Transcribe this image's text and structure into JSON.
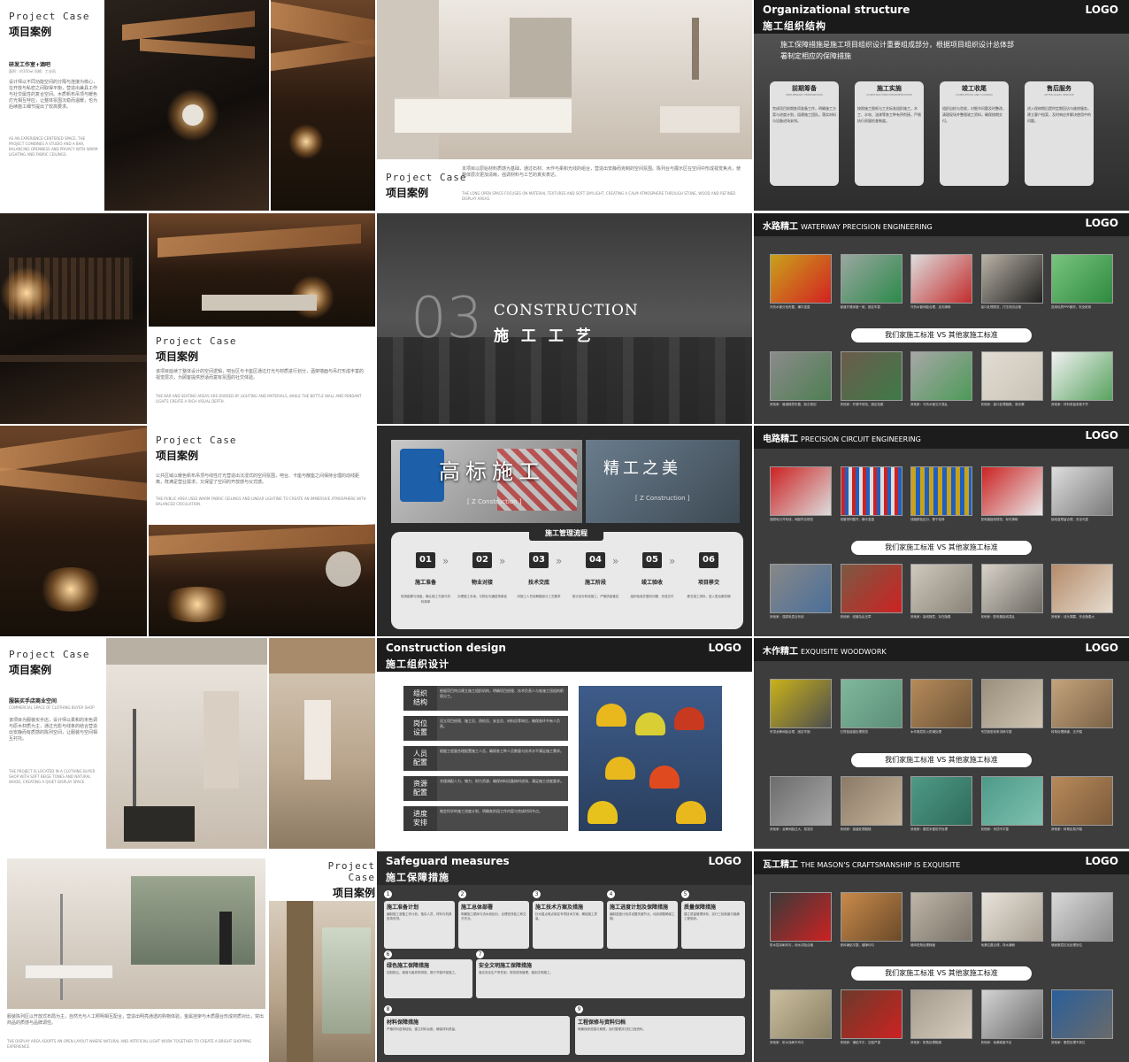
{
  "project_case": {
    "en": "Project Case",
    "cn": "项目案例"
  },
  "s1": {
    "subtitle": "研发工作室+酒吧",
    "meta": "面积：约350㎡ 风格：工业风",
    "body": "设计师以不同功能空间的分隔与连接为核心，在开放与私密之间取得平衡，营造出兼具工作与社交属性的复合空间。木质帆布吊顶与暖色灯光相互呼应，让整体氛围沉稳而温暖，也为后续施工细节提出了较高要求。",
    "body_en": "AS AN EXPERIENCE-CENTERED SPACE, THE PROJECT COMBINES A STUDIO AND A BAR, BALANCING OPENNESS AND PRIVACY WITH WARM LIGHTING AND FABRIC CEILINGS."
  },
  "s2": {
    "body": "本项目以原始材料质感为基础，通过石材、木作与柔和光线的组合，营造出安静而克制的空间氛围。陈列台与展示区在空间中形成视觉焦点，使整体层次更加清晰，强调材料与工艺的真实表达。",
    "body_en": "THE LONG OPEN SPACE FOCUSES ON MATERIAL TEXTURES AND SOFT DAYLIGHT, CREATING A CALM ATMOSPHERE THROUGH STONE, WOOD AND REFINED DISPLAY AREAS."
  },
  "s3": {
    "en": "Organizational structure",
    "cn": "施工组织结构",
    "logo": "LOGO",
    "intro": "施工保障措施是施工项目组织设计重要组成部分，根据项目组织设计总体部署制定相应的保障措施",
    "cards": [
      {
        "title": "前期筹备",
        "en": "PRELIMINARY PREPARATION",
        "body": "完成项目前期各项准备工作，明确施工方案与进度计划，组建施工团队，落实材料与设备进场安排。"
      },
      {
        "title": "施工实施",
        "en": "CONSTRUCTION IMPLEMENTATION",
        "body": "按照施工图纸与工艺标准组织施工，木工、水电、油漆等各工种有序衔接，严格执行质量检查制度。"
      },
      {
        "title": "竣工收尾",
        "en": "COMPLETION AND CLOSING",
        "body": "组织自检与验收，对细节问题及时整改，清理现场并整理竣工资料，确保按期交付。"
      },
      {
        "title": "售后服务",
        "en": "AFTER-SALES SERVICE",
        "body": "进入保修期后提供定期回访与维修服务，建立客户档案，及时响应并解决使用中的问题。"
      }
    ]
  },
  "s4": {
    "body": "该项目延续了整体设计的空间逻辑，吧台区与卡座区通过灯光与材质进行划分，酒架墙面与吊灯形成丰富的视觉层次，为顾客提供舒适而富有氛围的社交体验。",
    "body_en": "THE BAR AND SEATING AREAS ARE DIVIDED BY LIGHTING AND MATERIALS, WHILE THE BOTTLE WALL AND PENDANT LIGHTS CREATE A RICH VISUAL DEPTH."
  },
  "s5": {
    "num": "03",
    "en": "CONSTRUCTION",
    "cn": "施 工 工 艺"
  },
  "s6": {
    "title": "水路精工",
    "title_en": "WATERWAY PRECISION ENGINEERING",
    "logo": "LOGO",
    "vs": "我们家施工标准  VS  其他家施工标准",
    "caps_top": [
      "冷热水管分色布置，横平竖直",
      "管道开槽深度一致，固定牢靠",
      "冷热水管间距合理，走向清晰",
      "接口处理规范，打压测试合格",
      "选用优质PPR管材，安全耐用"
    ],
    "caps_bottom": [
      "其他家：管道随意布置，缺乏规划",
      "其他家：开槽不规范，固定松散",
      "其他家：冷热水管交叉混乱",
      "其他家：接口处理粗糙，易渗漏",
      "其他家：材料质量参差不齐"
    ]
  },
  "s7": {
    "body": "公共区域以暖色帆布吊顶与线性灯光营造出沉浸式的空间氛围，吧台、卡座与散座之间保持合理的动线距离，既满足营业需求，又保留了空间的开放感与仪式感。",
    "body_en": "THE PUBLIC AREA USES WARM FABRIC CEILINGS AND LINEAR LIGHTING TO CREATE AN IMMERSIVE ATMOSPHERE WITH BALANCED CIRCULATION."
  },
  "s8": {
    "banner_left": "高标施工",
    "banner_left_sub": "[ Z Construction ]",
    "banner_right": "精工之美",
    "banner_right_sub": "[ Z Construction ]",
    "process_title": "施工管理流程",
    "steps": [
      {
        "num": "01",
        "name": "施工准备",
        "desc": "现场勘察与测量，确认施工方案与材料清单"
      },
      {
        "num": "02",
        "name": "物业对接",
        "desc": "办理施工手续，与物业沟通进场事宜"
      },
      {
        "num": "03",
        "name": "技术交底",
        "desc": "向施工人员讲解图纸与工艺要求"
      },
      {
        "num": "04",
        "name": "施工阶段",
        "desc": "按计划分阶段施工，严格质量管控"
      },
      {
        "num": "05",
        "name": "竣工验收",
        "desc": "组织验收并整改问题，完成交付"
      },
      {
        "num": "06",
        "name": "项目移交",
        "desc": "移交竣工资料，进入售后服务期"
      }
    ]
  },
  "s9": {
    "title": "电路精工",
    "title_en": "PRECISION CIRCUIT ENGINEERING",
    "logo": "LOGO",
    "vs": "我们家施工标准  VS  其他家施工标准",
    "caps_top": [
      "强弱电分开布线，间距符合规范",
      "线管排列整齐，横平竖直",
      "线路颜色区分，便于检修",
      "配电箱接线规范，标识清晰",
      "接线盒预留合理，安全可靠"
    ],
    "caps_bottom": [
      "其他家：强弱电混合布线",
      "其他家：线管杂乱无章",
      "其他家：接线随意，存在隐患",
      "其他家：配电箱接线混乱",
      "其他家：线头裸露，安全隐患大"
    ]
  },
  "s10": {
    "subtitle": "服装买手店商业空间",
    "subtitle_en": "COMMERCIAL SPACE OF CLOTHING BUYER SHOP",
    "body": "该项目为服装买手店，设计师以柔和的米色调与原木材质为主，通过光影与线条的结合营造出安静而有质感的陈列空间，让服装与空间相互衬托。",
    "body_en": "THE PROJECT IS LOCATED IN A CLOTHING BUYER SHOP WITH SOFT BEIGE TONES AND NATURAL WOOD, CREATING A QUIET DISPLAY SPACE."
  },
  "s11": {
    "en": "Construction design",
    "cn": "施工组织设计",
    "logo": "LOGO",
    "rows": [
      {
        "k": "组织\n结构",
        "v": "根据项目特点建立施工组织机构，明确项目经理、技术负责人与各施工班组的职责分工。"
      },
      {
        "k": "岗位\n设置",
        "v": "设立项目经理、施工员、质检员、安全员、材料员等岗位，确保各环节有人负责。"
      },
      {
        "k": "人员\n配置",
        "v": "根据工程量合理配置施工人员，确保各工种人员数量与技术水平满足施工需求。"
      },
      {
        "k": "资源\n配置",
        "v": "合理调配人力、物力、财力资源，确保材料设备按时进场，满足施工进度要求。"
      },
      {
        "k": "进度\n安排",
        "v": "制定科学的施工进度计划，明确各阶段工作内容与完成时间节点。"
      }
    ]
  },
  "s12": {
    "title": "木作精工",
    "title_en": "EXQUISITE WOODWORK",
    "logo": "LOGO",
    "vs": "我们家施工标准  VS  其他家施工标准",
    "caps_top": [
      "吊顶龙骨间距合理，固定牢固",
      "石膏板接缝处理规范",
      "木作基层防火防潮处理",
      "吊顶造型线条流畅平整",
      "转角处理精细，无开裂"
    ],
    "caps_bottom": [
      "其他家：龙骨间距过大，易变形",
      "其他家：接缝处理粗糙",
      "其他家：基层未做防护处理",
      "其他家：吊顶不平整",
      "其他家：转角处易开裂"
    ]
  },
  "s13": {
    "body": "服装陈列区以开放式布局为主，自然光与人工照明相互配合，营造出明亮通透的购物体验，金属挂架与木质展台形成材质对比，突出商品的质感与品牌调性。",
    "body_en": "THE DISPLAY AREA ADOPTS AN OPEN LAYOUT WHERE NATURAL AND ARTIFICIAL LIGHT WORK TOGETHER TO CREATE A BRIGHT SHOPPING EXPERIENCE."
  },
  "s14": {
    "en": "Safeguard measures",
    "cn": "施工保障措施",
    "logo": "LOGO",
    "items": [
      {
        "n": "1",
        "title": "施工准备计划",
        "desc": "编制施工准备工作计划，落实人员、材料与机具进场安排。"
      },
      {
        "n": "2",
        "title": "施工总体部署",
        "desc": "明确施工顺序与流水段划分，合理安排各工种交叉作业。"
      },
      {
        "n": "3",
        "title": "施工技术方案及措施",
        "desc": "针对重点难点制定专项技术方案，确保施工质量。"
      },
      {
        "n": "4",
        "title": "施工进度计划及保障措施",
        "desc": "编制进度计划并设置关键节点，动态调整确保工期。"
      },
      {
        "n": "5",
        "title": "质量保障措施",
        "desc": "建立质量管理体系，实行三检制度与隐蔽工程验收。"
      },
      {
        "n": "6",
        "title": "绿色施工保障措施",
        "desc": "控制扬尘、噪音与废弃物排放，推行节能环保施工。"
      },
      {
        "n": "7",
        "title": "安全文明施工保障措施",
        "desc": "落实安全生产责任制，规范现场管理，做到文明施工。"
      },
      {
        "n": "8",
        "title": "材料保障措施",
        "desc": "严格材料进场检验，建立材料台账，确保材料质量。"
      },
      {
        "n": "9",
        "title": "工程保修与资料归档",
        "desc": "明确保修范围与期限，及时整理并归档工程资料。"
      }
    ]
  },
  "s15": {
    "title": "瓦工精工",
    "title_en": "THE MASON'S CRAFTSMANSHIP IS EXQUISITE",
    "logo": "LOGO",
    "vs": "我们家施工标准  VS  其他家施工标准",
    "caps_top": [
      "防水层涂刷均匀，闭水试验合格",
      "瓷砖铺贴平整，缝隙均匀",
      "墙砖阳角处理精细",
      "地漏位置合理，排水通畅",
      "墙面基层拉毛处理到位"
    ],
    "caps_bottom": [
      "其他家：防水涂刷不均匀",
      "其他家：铺贴不平，空鼓严重",
      "其他家：阳角处理粗糙",
      "其他家：地漏坡度不足",
      "其他家：基层处理不到位"
    ]
  },
  "colors": {
    "accent": "#2b2b2b",
    "dark": "#1c1c1c",
    "card": "#e6e6e6"
  }
}
